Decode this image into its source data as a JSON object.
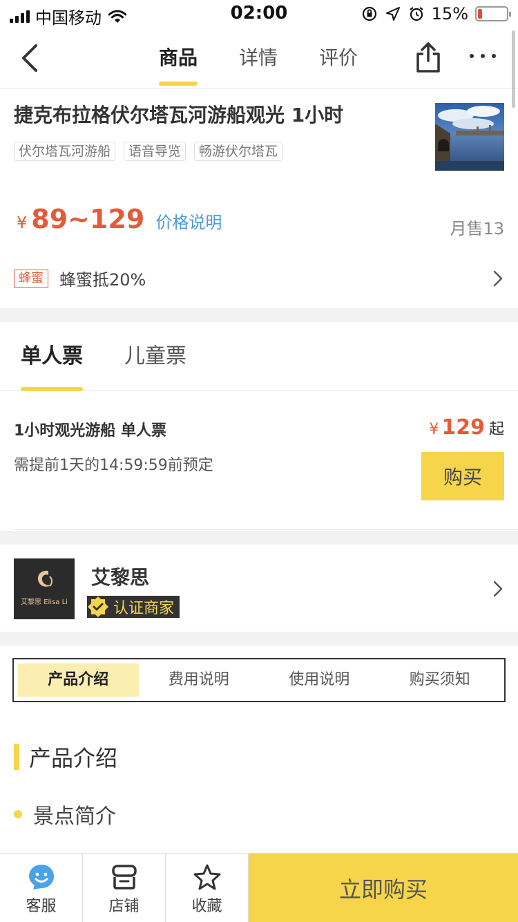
{
  "status_bar": {
    "carrier": "中国移动",
    "time": "02:00",
    "battery_percent": "15%",
    "battery_level": 0.15,
    "battery_color": "#e84c3d"
  },
  "nav": {
    "tabs": [
      {
        "label": "商品",
        "active": true
      },
      {
        "label": "详情",
        "active": false
      },
      {
        "label": "评价",
        "active": false
      }
    ],
    "icons": [
      "back-icon",
      "share-icon",
      "more-icon"
    ]
  },
  "product": {
    "title": "捷克布拉格伏尔塔瓦河游船观光 1小时",
    "tags": [
      "伏尔塔瓦河游船",
      "语音导览",
      "畅游伏尔塔瓦"
    ],
    "currency": "¥",
    "price_range": "89~129",
    "price_note": "价格说明",
    "monthly_sales": "月售13",
    "promo_tag": "蜂蜜",
    "promo_text": "蜂蜜抵20%"
  },
  "tickets": {
    "tabs": [
      {
        "label": "单人票",
        "active": true
      },
      {
        "label": "儿童票",
        "active": false
      }
    ],
    "item": {
      "name": "1小时观光游船 单人票",
      "note": "需提前1天的14:59:59前预定",
      "currency": "¥",
      "price": "129",
      "price_suffix": "起",
      "buy_label": "购买"
    }
  },
  "shop": {
    "name": "艾黎思",
    "logo_text": "艾黎思 Elisa Li",
    "badge": "认证商家"
  },
  "section_tabs": [
    {
      "label": "产品介绍",
      "active": true
    },
    {
      "label": "费用说明",
      "active": false
    },
    {
      "label": "使用说明",
      "active": false
    },
    {
      "label": "购买须知",
      "active": false
    }
  ],
  "content": {
    "section_title": "产品介绍",
    "sub_title": "景点简介"
  },
  "bottom_bar": {
    "service": "客服",
    "store": "店铺",
    "favorite": "收藏",
    "buy_now": "立即购买"
  },
  "colors": {
    "accent": "#f6d54b",
    "price": "#e35c3a",
    "link": "#4a9ad6"
  }
}
